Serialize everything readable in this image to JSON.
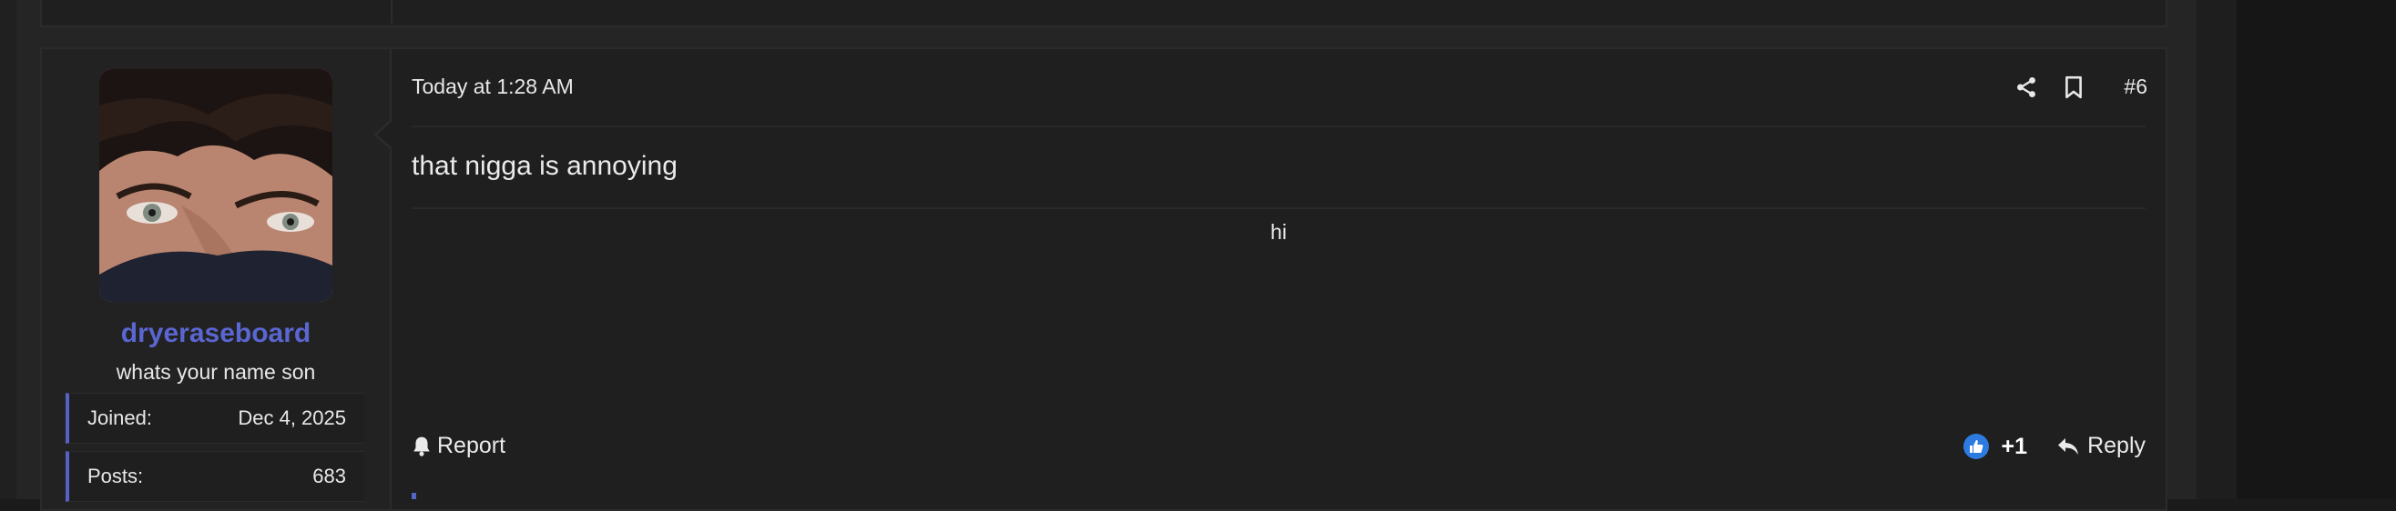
{
  "previous_post": {},
  "post": {
    "user": {
      "username": "dryeraseboard",
      "title": "whats your name son",
      "avatar_alt": "avatar",
      "extras": [
        {
          "label": "Joined:",
          "value": "Dec 4, 2025"
        },
        {
          "label": "Posts:",
          "value": "683"
        }
      ]
    },
    "header": {
      "date": "Today at 1:28 AM",
      "share_icon": "share-icon",
      "bookmark_icon": "bookmark-icon",
      "post_number": "#6"
    },
    "body": {
      "message": "that nigga is annoying",
      "signature": "hi"
    },
    "footer": {
      "report_label": "Report",
      "report_icon": "bell-icon",
      "reaction_icon": "thumbs-up-icon",
      "reaction_count": "+1",
      "reply_label": "Reply",
      "reply_icon": "reply-icon"
    }
  },
  "colors": {
    "accent": "#5563c7",
    "username": "#5a66d1",
    "like_blue": "#2d7be0"
  }
}
